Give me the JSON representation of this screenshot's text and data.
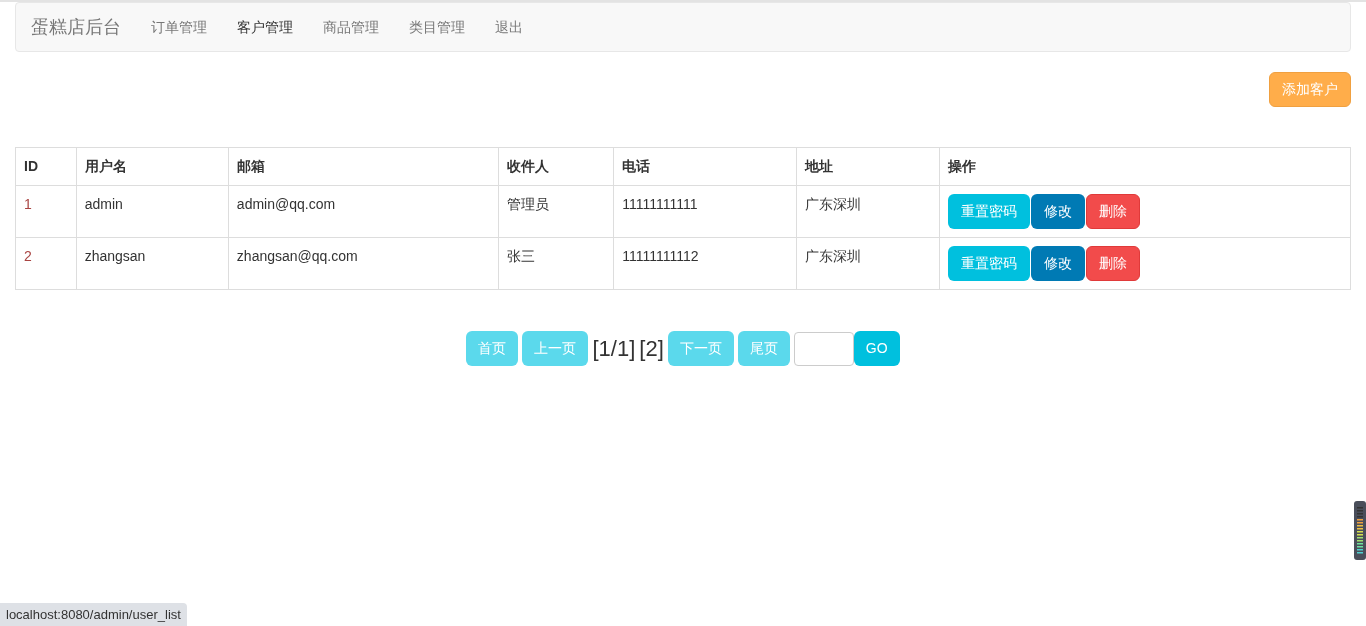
{
  "navbar": {
    "brand": "蛋糕店后台",
    "items": [
      {
        "label": "订单管理",
        "selected": false
      },
      {
        "label": "客户管理",
        "selected": true
      },
      {
        "label": "商品管理",
        "selected": false
      },
      {
        "label": "类目管理",
        "selected": false
      },
      {
        "label": "退出",
        "selected": false
      }
    ]
  },
  "add_button": "添加客户",
  "table": {
    "columns": [
      "ID",
      "用户名",
      "邮箱",
      "收件人",
      "电话",
      "地址",
      "操作"
    ],
    "rows": [
      {
        "cells": [
          "1",
          "admin",
          "admin@qq.com",
          "管理员",
          "11111111111",
          "广东深圳"
        ],
        "actions": [
          {
            "label": "重置密码",
            "kind": "info"
          },
          {
            "label": "修改",
            "kind": "primary"
          },
          {
            "label": "删除",
            "kind": "danger"
          }
        ]
      },
      {
        "cells": [
          "2",
          "zhangsan",
          "zhangsan@qq.com",
          "张三",
          "11111111112",
          "广东深圳"
        ],
        "actions": [
          {
            "label": "重置密码",
            "kind": "info"
          },
          {
            "label": "修改",
            "kind": "primary"
          },
          {
            "label": "删除",
            "kind": "danger"
          }
        ]
      }
    ]
  },
  "pagination": {
    "before": [
      {
        "label": "首页",
        "disabled": true
      },
      {
        "label": "上一页",
        "disabled": true
      }
    ],
    "current": "[1/1]",
    "pages": [
      "[2]"
    ],
    "after": [
      {
        "label": "下一页",
        "disabled": true
      },
      {
        "label": "尾页",
        "disabled": true
      }
    ],
    "go": "GO"
  },
  "status_bar": "localhost:8080/admin/user_list"
}
